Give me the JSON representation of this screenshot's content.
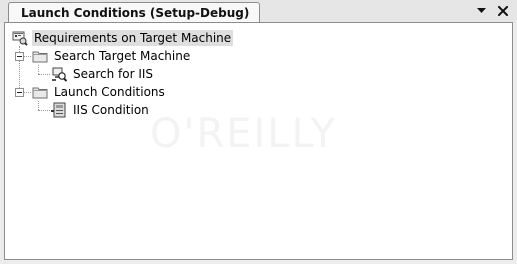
{
  "tab": {
    "title": "Launch Conditions (Setup-Debug)"
  },
  "controls": {
    "menu_glyph": "▼",
    "close_glyph": "✕"
  },
  "tree": {
    "root": "Requirements on Target Machine",
    "search_group": "Search Target Machine",
    "search_item": "Search for IIS",
    "launch_group": "Launch Conditions",
    "launch_item": "IIS Condition"
  },
  "icons": {
    "root": "requirements-icon",
    "folder": "folder-icon",
    "search": "search-machine-icon",
    "condition": "condition-icon"
  },
  "watermark": "O'REILLY"
}
